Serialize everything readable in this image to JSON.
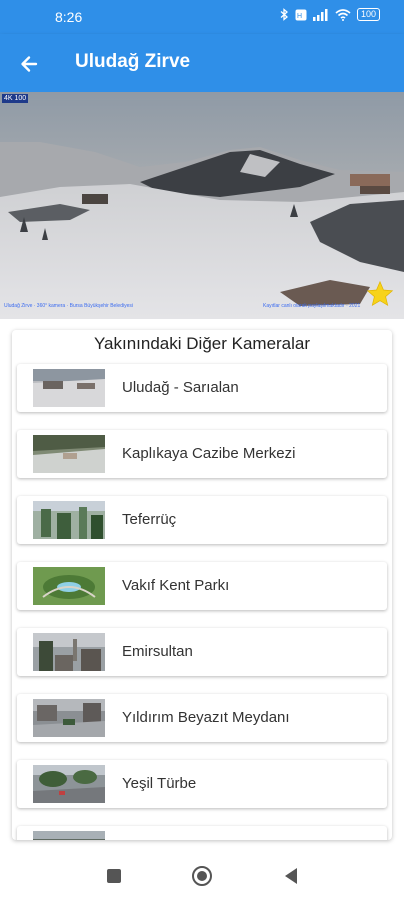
{
  "status": {
    "time": "8:26",
    "battery": "100",
    "icons": [
      "bluetooth-icon",
      "volte-icon",
      "signal-icon",
      "wifi-icon",
      "battery-icon"
    ]
  },
  "app_bar": {
    "title": "Uludağ Zirve",
    "back_icon": "arrow-left-icon",
    "color": "#2f8fe8"
  },
  "camera": {
    "corner_label": "4K 100",
    "caption_left": "Uludağ Zirve · 360° kamera · Bursa Büyükşehir Belediyesi",
    "caption_right": "Kayıtlar canlı olarak paylaşılmaktadır · 2021",
    "favorite_icon": "star-icon",
    "favorite_color": "#f7d31b"
  },
  "nearby": {
    "title": "Yakınındaki Diğer Kameralar",
    "items": [
      {
        "label": "Uludağ - Sarıalan",
        "thumb": "snow"
      },
      {
        "label": "Kaplıkaya Cazibe Merkezi",
        "thumb": "valley"
      },
      {
        "label": "Teferrüç",
        "thumb": "cable"
      },
      {
        "label": "Vakıf Kent Parkı",
        "thumb": "park"
      },
      {
        "label": "Emirsultan",
        "thumb": "mosque"
      },
      {
        "label": "Yıldırım Beyazıt Meydanı",
        "thumb": "square"
      },
      {
        "label": "Yeşil Türbe",
        "thumb": "street"
      },
      {
        "label": "",
        "thumb": "partial"
      }
    ]
  },
  "nav": {
    "recents_icon": "square-icon",
    "home_icon": "circle-icon",
    "back_icon": "triangle-back-icon"
  }
}
